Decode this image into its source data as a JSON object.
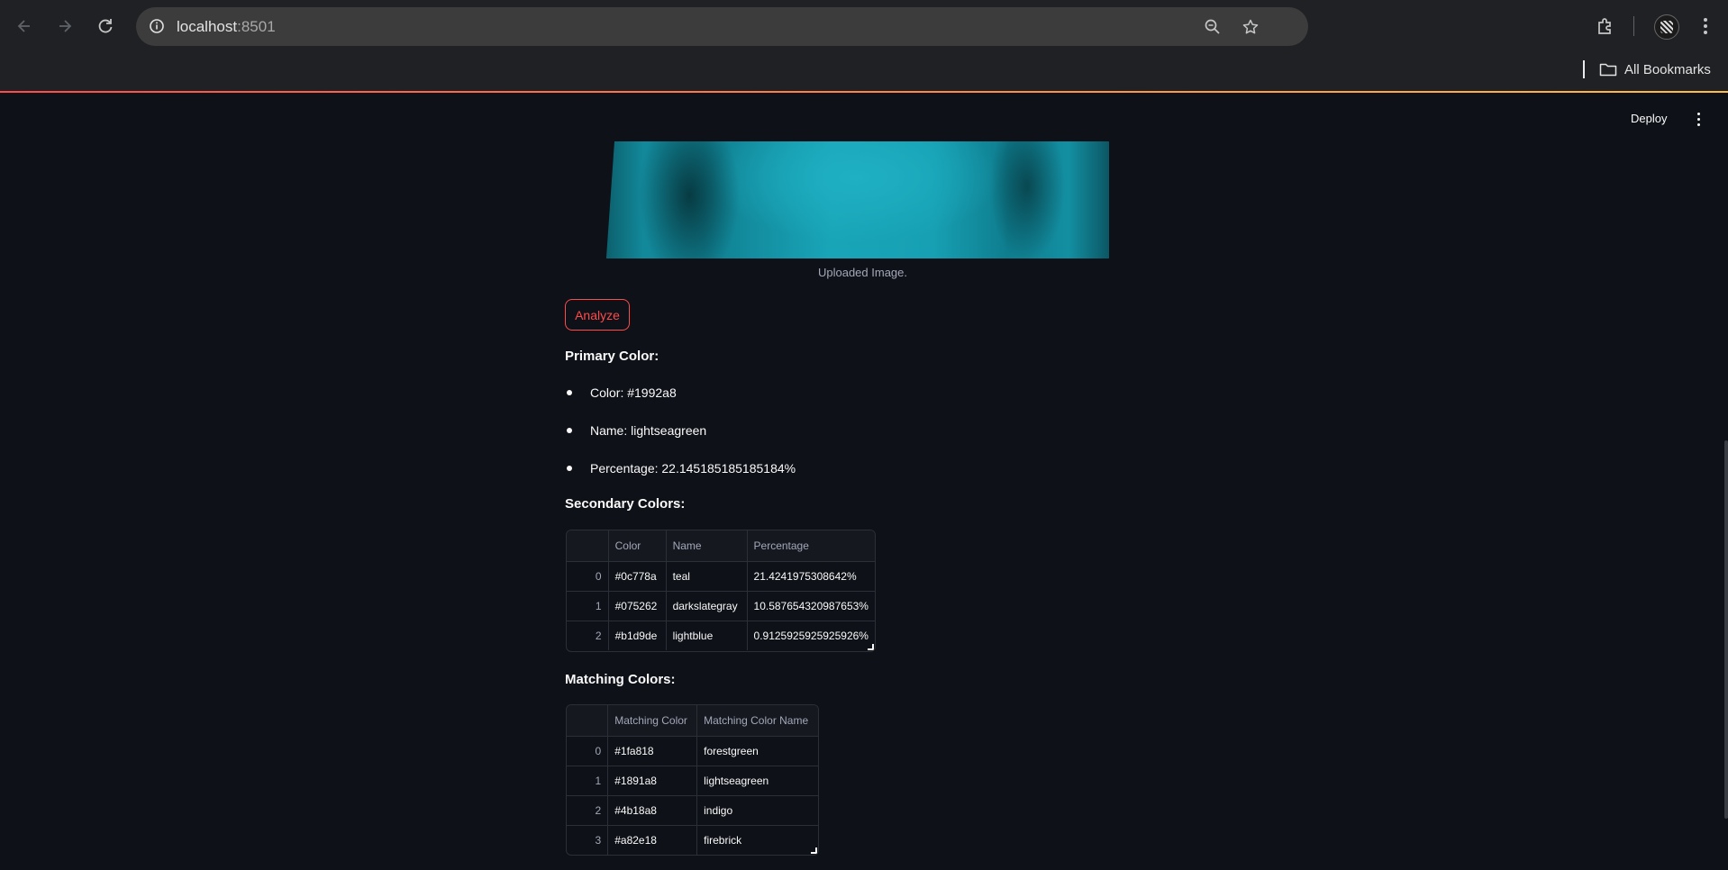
{
  "browser": {
    "url_host": "localhost",
    "url_port": ":8501",
    "bookmarks_label": "All Bookmarks"
  },
  "header": {
    "deploy_label": "Deploy"
  },
  "image": {
    "caption": "Uploaded Image."
  },
  "actions": {
    "analyze_label": "Analyze"
  },
  "primary": {
    "heading": "Primary Color:",
    "color": "Color: #1992a8",
    "name": "Name: lightseagreen",
    "percentage": "Percentage: 22.145185185185184%"
  },
  "secondary": {
    "heading": "Secondary Colors:",
    "columns": [
      "",
      "Color",
      "Name",
      "Percentage"
    ],
    "rows": [
      [
        "0",
        "#0c778a",
        "teal",
        "21.4241975308642%"
      ],
      [
        "1",
        "#075262",
        "darkslategray",
        "10.587654320987653%"
      ],
      [
        "2",
        "#b1d9de",
        "lightblue",
        "0.9125925925925926%"
      ]
    ]
  },
  "matching": {
    "heading": "Matching Colors:",
    "columns": [
      "",
      "Matching Color",
      "Matching Color Name"
    ],
    "rows": [
      [
        "0",
        "#1fa818",
        "forestgreen"
      ],
      [
        "1",
        "#1891a8",
        "lightseagreen"
      ],
      [
        "2",
        "#4b18a8",
        "indigo"
      ],
      [
        "3",
        "#a82e18",
        "firebrick"
      ]
    ]
  },
  "colors": {
    "accent": "#ff4b4b",
    "background": "#0e1117",
    "text": "#fafafa"
  }
}
